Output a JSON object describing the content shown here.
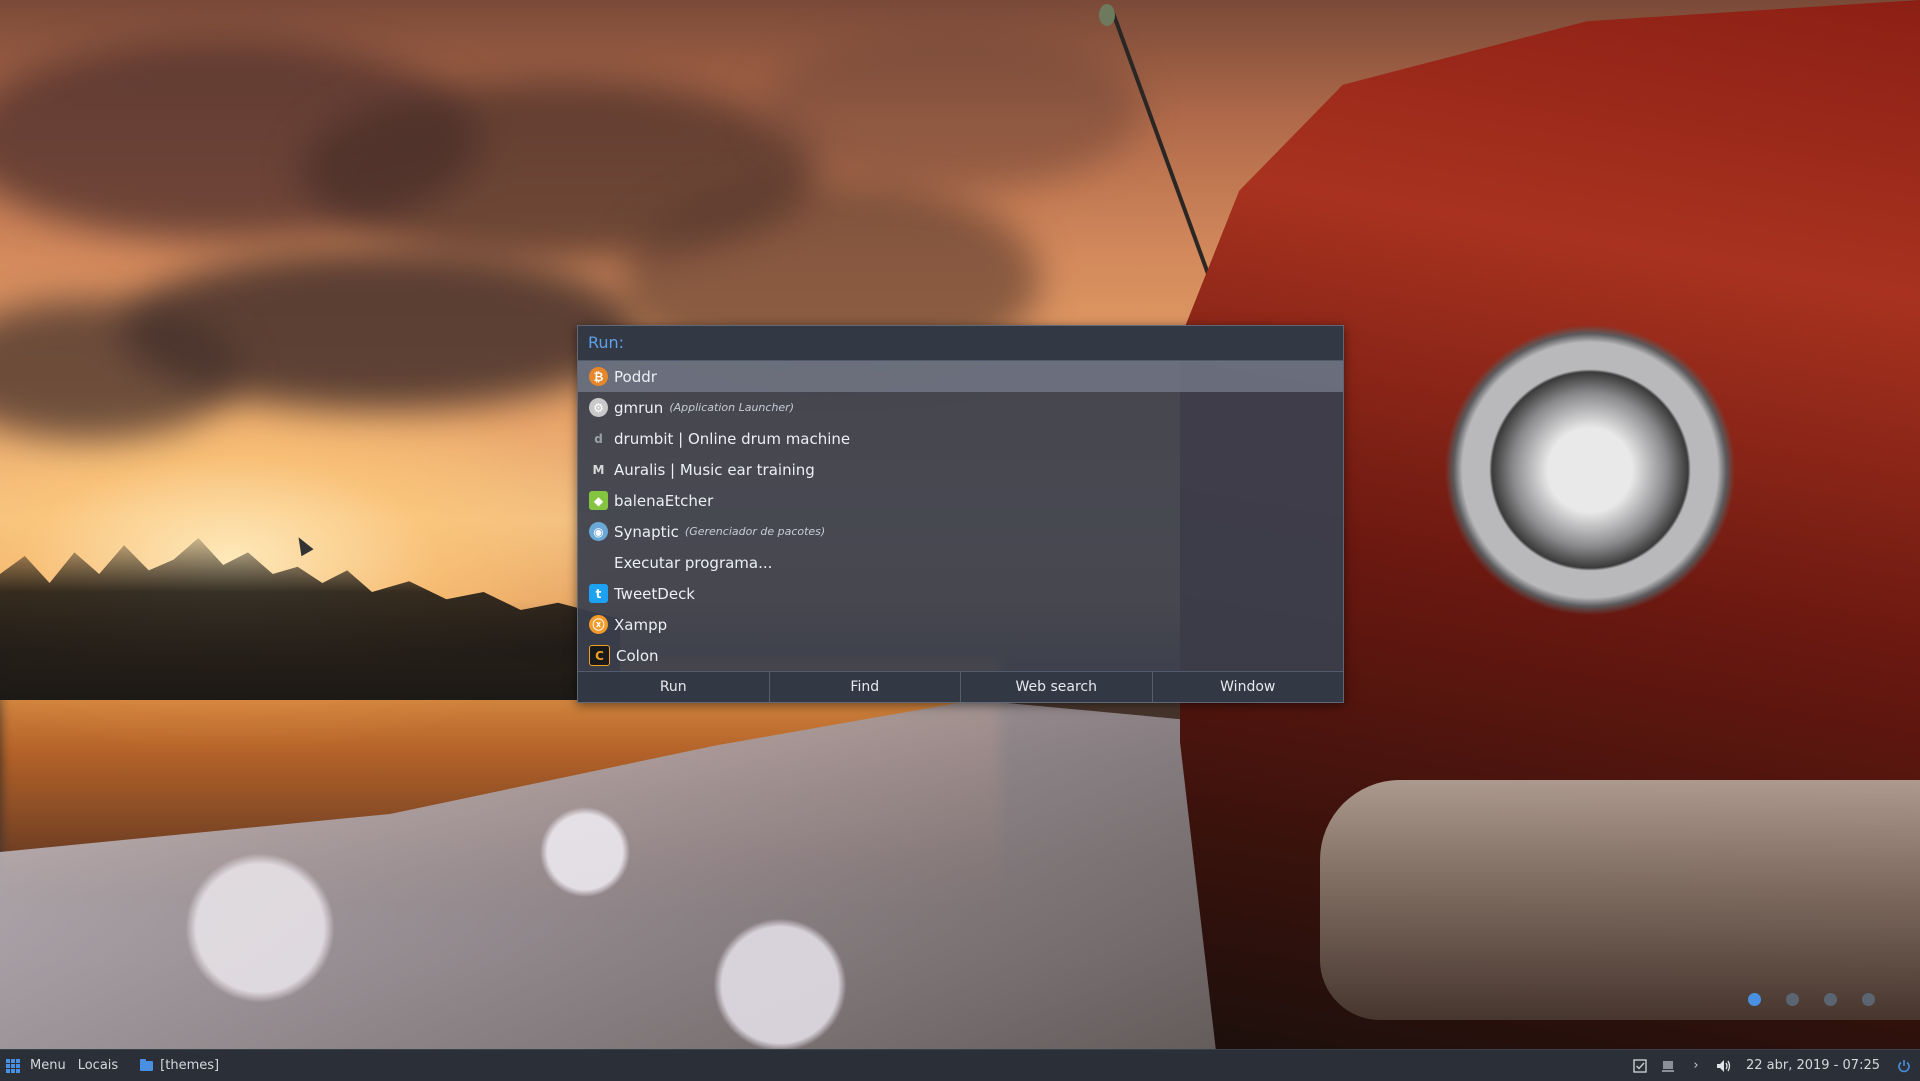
{
  "run_dialog": {
    "header": "Run:",
    "items": [
      {
        "label": "Poddr",
        "sub": "",
        "icon": "poddr-icon",
        "icon_glyph": "₿",
        "icon_color": "#e7872a",
        "selected": true
      },
      {
        "label": "gmrun",
        "sub": "(Application Launcher)",
        "icon": "gmrun-icon",
        "icon_glyph": "⚙",
        "icon_color": "#c9c9c9",
        "selected": false
      },
      {
        "label": "drumbit | Online drum machine",
        "sub": "",
        "icon": "drumbit-icon",
        "icon_glyph": "d",
        "icon_color": "#9aa0a8",
        "selected": false
      },
      {
        "label": "Auralis | Music ear training",
        "sub": "",
        "icon": "auralis-icon",
        "icon_glyph": "M",
        "icon_color": "#d8d8d8",
        "selected": false
      },
      {
        "label": "balenaEtcher",
        "sub": "",
        "icon": "balenaetcher-icon",
        "icon_glyph": "◆",
        "icon_color": "#85c440",
        "selected": false
      },
      {
        "label": "Synaptic",
        "sub": "(Gerenciador de pacotes)",
        "icon": "synaptic-icon",
        "icon_glyph": "◉",
        "icon_color": "#6aa8d8",
        "selected": false
      },
      {
        "label": "Executar programa...",
        "sub": "",
        "icon": "",
        "icon_glyph": "",
        "icon_color": "",
        "selected": false
      },
      {
        "label": "TweetDeck",
        "sub": "",
        "icon": "tweetdeck-icon",
        "icon_glyph": "t",
        "icon_color": "#1da1f2",
        "selected": false
      },
      {
        "label": "Xampp",
        "sub": "",
        "icon": "xampp-icon",
        "icon_glyph": "ⓧ",
        "icon_color": "#f39a2b",
        "selected": false
      },
      {
        "label": "Colon",
        "sub": "",
        "icon": "colon-icon",
        "icon_glyph": "C",
        "icon_color": "#f0a020",
        "selected": false
      }
    ],
    "buttons": [
      "Run",
      "Find",
      "Web search",
      "Window"
    ]
  },
  "workspaces": {
    "count": 4,
    "active_index": 0
  },
  "panel": {
    "menu_label": "Menu",
    "places_label": "Locais",
    "window_label": "[themes]",
    "clock": "22 abr, 2019 - 07:25",
    "tray_icons": [
      "tasks-icon",
      "screen-icon",
      "chevron-right-icon",
      "volume-icon"
    ],
    "accent": "#4a90e2"
  }
}
